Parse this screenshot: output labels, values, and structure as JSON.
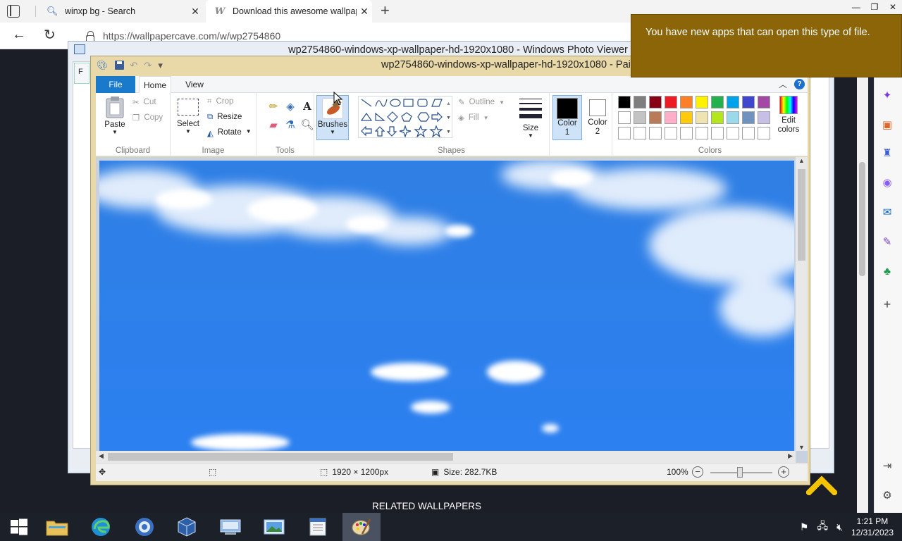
{
  "browser": {
    "tabs": [
      {
        "title": "winxp bg - Search"
      },
      {
        "title": "Download this awesome wallpaper"
      }
    ],
    "url": "https://wallpapercave.com/w/wp2754860"
  },
  "photo_viewer": {
    "title": "wp2754860-windows-xp-wallpaper-hd-1920x1080 - Windows Photo Viewer",
    "menu_letter": "F"
  },
  "paint": {
    "title": "wp2754860-windows-xp-wallpaper-hd-1920x1080 - Paint",
    "tabs": {
      "file": "File",
      "home": "Home",
      "view": "View"
    },
    "clipboard": {
      "paste": "Paste",
      "cut": "Cut",
      "copy": "Copy",
      "label": "Clipboard"
    },
    "image": {
      "select": "Select",
      "crop": "Crop",
      "resize": "Resize",
      "rotate": "Rotate",
      "label": "Image"
    },
    "tools": {
      "label": "Tools"
    },
    "brushes": {
      "label": "Brushes"
    },
    "shapes": {
      "outline": "Outline",
      "fill": "Fill",
      "label": "Shapes"
    },
    "size": {
      "label": "Size"
    },
    "color1": {
      "line1": "Color",
      "line2": "1"
    },
    "color2": {
      "line1": "Color",
      "line2": "2"
    },
    "edit_colors": {
      "line1": "Edit",
      "line2": "colors"
    },
    "colors_label": "Colors",
    "palette_row1": [
      "#000000",
      "#7f7f7f",
      "#880015",
      "#ed1c24",
      "#ff7f27",
      "#fff200",
      "#22b14c",
      "#00a2e8",
      "#3f48cc",
      "#a349a4"
    ],
    "palette_row2": [
      "#ffffff",
      "#c3c3c3",
      "#b97a57",
      "#ffaec9",
      "#ffc90e",
      "#efe4b0",
      "#b5e61d",
      "#99d9ea",
      "#7092be",
      "#c8bfe7"
    ],
    "status": {
      "dimensions": "1920 × 1200px",
      "size": "Size: 282.7KB",
      "zoom": "100%"
    }
  },
  "page": {
    "related": "RELATED WALLPAPERS"
  },
  "notification": {
    "text": "You have new apps that can open this type of file."
  },
  "taskbar": {
    "time": "1:21 PM",
    "date": "12/31/2023"
  }
}
